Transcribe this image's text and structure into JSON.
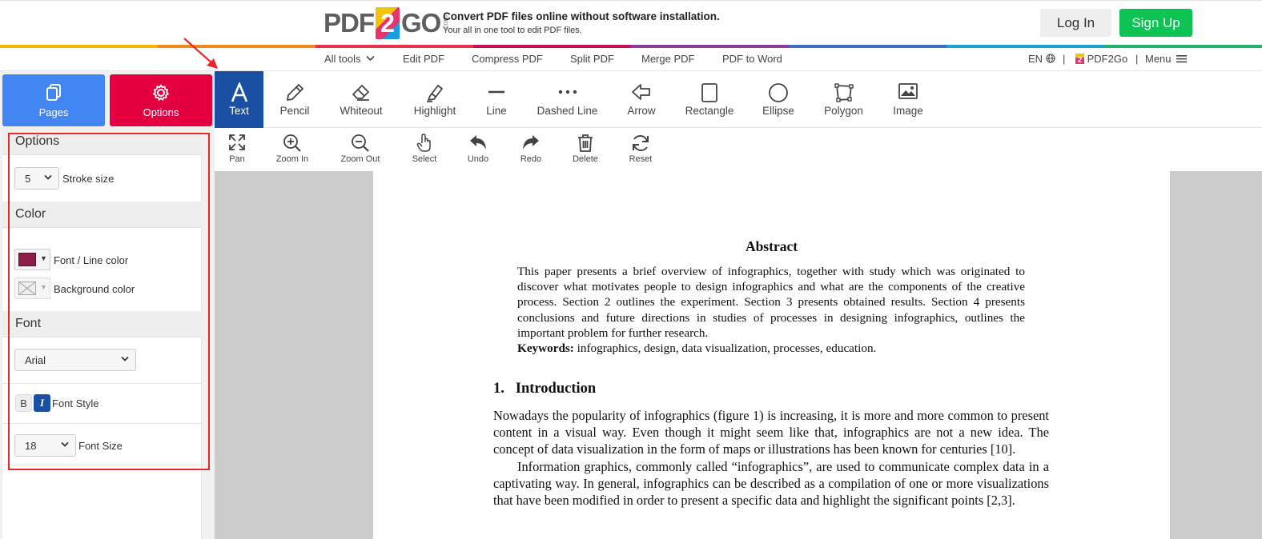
{
  "header": {
    "logo_left": "PDF",
    "logo_mid": "2",
    "logo_right": "GO",
    "logo_com": ".com",
    "tagline_main": "Convert PDF files online without software installation.",
    "tagline_sub": "Your all in one tool to edit PDF files.",
    "login_label": "Log In",
    "signup_label": "Sign Up"
  },
  "nav": {
    "items": [
      "All tools",
      "Edit PDF",
      "Compress PDF",
      "Split PDF",
      "Merge PDF",
      "PDF to Word"
    ],
    "lang": "EN",
    "sep1": "|",
    "brand": "PDF2Go",
    "sep2": "|",
    "menu": "Menu"
  },
  "sidebar": {
    "pages_label": "Pages",
    "options_label": "Options"
  },
  "options": {
    "options_header": "Options",
    "stroke_value": "5",
    "stroke_label": "Stroke size",
    "color_header": "Color",
    "font_color_label": "Font / Line color",
    "font_color": "#8e1d4b",
    "bg_color_label": "Background color",
    "font_header": "Font",
    "font_family_value": "Arial",
    "bold_label": "B",
    "italic_label": "I",
    "font_style_label": "Font Style",
    "font_size_value": "18",
    "font_size_label": "Font Size"
  },
  "tools": {
    "text": "Text",
    "pencil": "Pencil",
    "whiteout": "Whiteout",
    "highlight": "Highlight",
    "line": "Line",
    "dashed_line": "Dashed Line",
    "arrow": "Arrow",
    "rectangle": "Rectangle",
    "ellipse": "Ellipse",
    "polygon": "Polygon",
    "image": "Image"
  },
  "view_tools": {
    "pan": "Pan",
    "zoom_in": "Zoom In",
    "zoom_out": "Zoom Out",
    "select": "Select",
    "undo": "Undo",
    "redo": "Redo",
    "delete": "Delete",
    "reset": "Reset"
  },
  "document": {
    "abstract_title": "Abstract",
    "abstract_text": "This paper presents a brief overview of infographics, together with study which was originated to discover what motivates people to design infographics and what are the components of the creative process. Section 2 outlines the experiment. Section 3 presents obtained results. Section 4 presents conclusions and future directions in studies of processes in designing infographics, outlines the important problem for further research.",
    "keywords_label": "Keywords:",
    "keywords_text": " infographics, design, data visualization, processes, education.",
    "section_title": "1.   Introduction",
    "para1": "Nowadays the popularity of infographics (figure 1) is increasing, it is more and more common to present content in a visual way. Even though it might seem like that, infographics are not a new idea. The concept of data visualization in the form of maps or illustrations has been known for centuries [10].",
    "para2": "Information graphics, commonly called “infographics”, are used to communicate complex data in a captivating way. In general, infographics can be described as a compilation of one or more visualizations that have been modified in order to present a specific data and highlight the significant points [2,3]."
  },
  "colors": {
    "accent_blue": "#4286f4",
    "accent_red": "#e40040",
    "active_tool": "#1a4fa3",
    "signup_green": "#0cc353",
    "annotation_red": "#e8292c"
  }
}
